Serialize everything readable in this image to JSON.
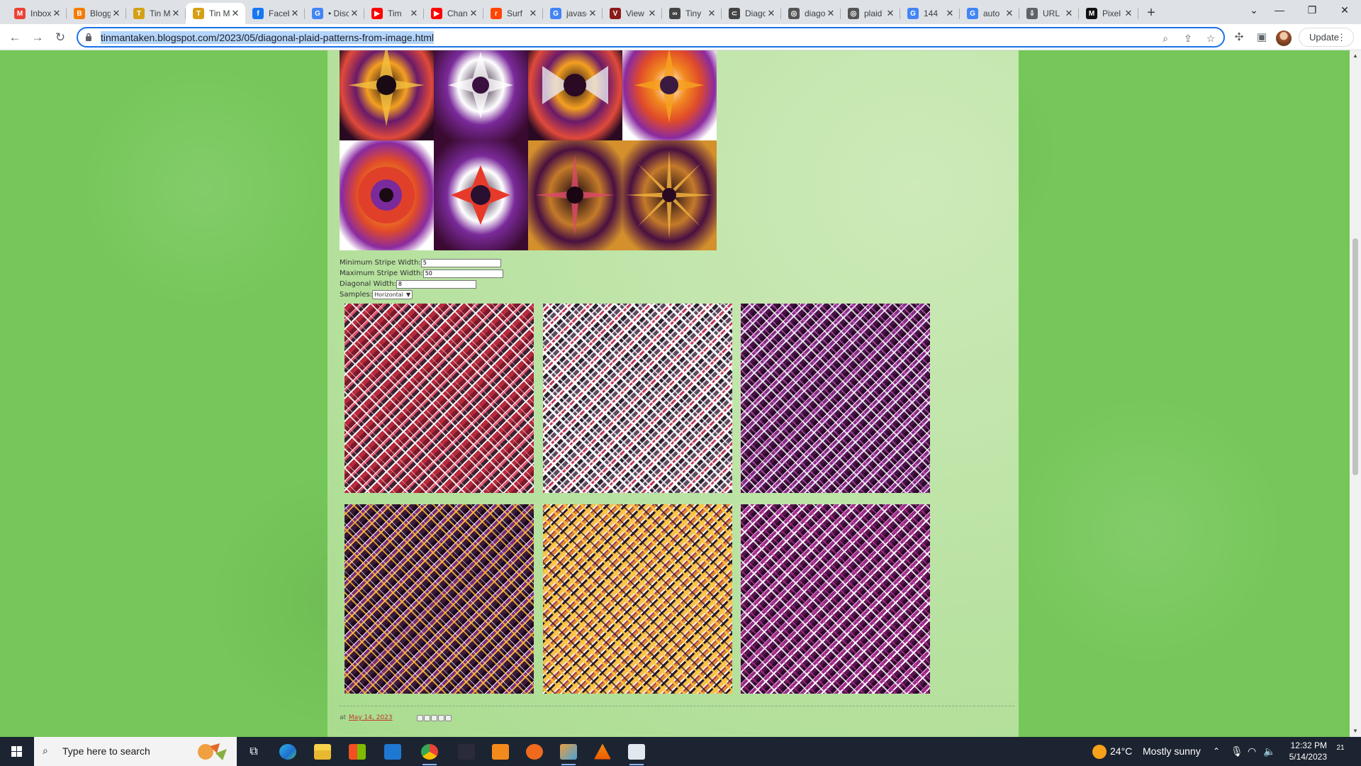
{
  "browser": {
    "tabs": [
      {
        "label": "Inbox",
        "favicon_color": "#ea4335",
        "favicon_glyph": "M",
        "active": false
      },
      {
        "label": "Blogger",
        "favicon_color": "#f57c00",
        "favicon_glyph": "B",
        "active": false
      },
      {
        "label": "Tin Man",
        "favicon_color": "#d4a017",
        "favicon_glyph": "T",
        "active": false
      },
      {
        "label": "Tin Man",
        "favicon_color": "#d4a017",
        "favicon_glyph": "T",
        "active": true
      },
      {
        "label": "Facebook",
        "favicon_color": "#1877f2",
        "favicon_glyph": "f",
        "active": false
      },
      {
        "label": "• Discover",
        "favicon_color": "#4285f4",
        "favicon_glyph": "G",
        "active": false
      },
      {
        "label": "Tim",
        "favicon_color": "#ff0000",
        "favicon_glyph": "▶",
        "active": false
      },
      {
        "label": "Channel",
        "favicon_color": "#ff0000",
        "favicon_glyph": "▶",
        "active": false
      },
      {
        "label": "Surf",
        "favicon_color": "#ff4500",
        "favicon_glyph": "r",
        "active": false
      },
      {
        "label": "javascript",
        "favicon_color": "#4285f4",
        "favicon_glyph": "G",
        "active": false
      },
      {
        "label": "View",
        "favicon_color": "#8b1a1a",
        "favicon_glyph": "V",
        "active": false
      },
      {
        "label": "Tiny",
        "favicon_color": "#444444",
        "favicon_glyph": "∞",
        "active": false
      },
      {
        "label": "Diagonal",
        "favicon_color": "#444444",
        "favicon_glyph": "⊂",
        "active": false
      },
      {
        "label": "diagonal",
        "favicon_color": "#555555",
        "favicon_glyph": "◎",
        "active": false
      },
      {
        "label": "plaid",
        "favicon_color": "#555555",
        "favicon_glyph": "◎",
        "active": false
      },
      {
        "label": "144",
        "favicon_color": "#4285f4",
        "favicon_glyph": "G",
        "active": false
      },
      {
        "label": "auto",
        "favicon_color": "#4285f4",
        "favicon_glyph": "G",
        "active": false
      },
      {
        "label": "URL",
        "favicon_color": "#5f6368",
        "favicon_glyph": "⇩",
        "active": false
      },
      {
        "label": "Pixel",
        "favicon_color": "#111111",
        "favicon_glyph": "M",
        "active": false
      }
    ],
    "new_tab_label": "+",
    "url": "tinmantaken.blogspot.com/2023/05/diagonal-plaid-patterns-from-image.html",
    "update_label": "Update"
  },
  "page": {
    "form": {
      "min_stripe_label": "Minimum Stripe Width:",
      "min_stripe_value": "5",
      "max_stripe_label": "Maximum Stripe Width:",
      "max_stripe_value": "50",
      "diagonal_label": "Diagonal Width:",
      "diagonal_value": "8",
      "samples_label": "Samples:",
      "samples_value": "Horizontal"
    },
    "footer": {
      "posted_at_label": "at",
      "date": "May 14, 2023"
    }
  },
  "taskbar": {
    "search_placeholder": "Type here to search",
    "weather_temp": "24°C",
    "weather_text": "Mostly sunny",
    "time": "12:32 PM",
    "date": "5/14/2023",
    "notification_count": "21"
  }
}
